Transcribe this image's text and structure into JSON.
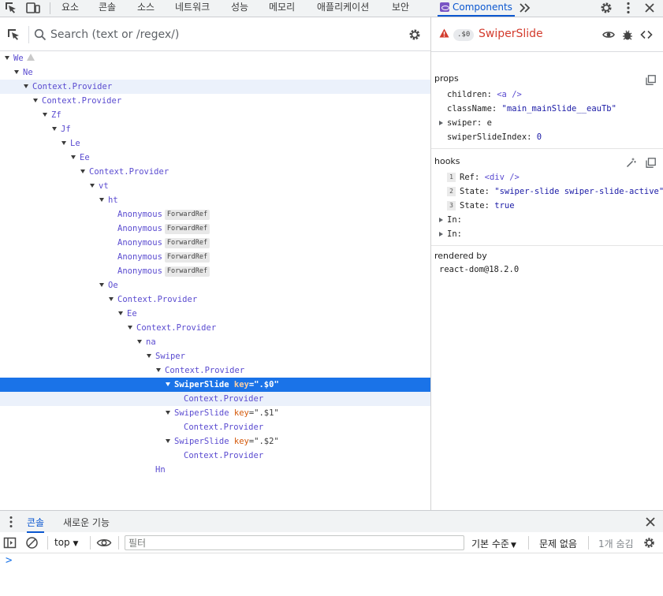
{
  "top_tabs": [
    "요소",
    "콘솔",
    "소스",
    "네트워크",
    "성능",
    "메모리",
    "애플리케이션",
    "보안"
  ],
  "active_tab": "Components",
  "more_tabs_icon": "chevron-double-right-icon",
  "search": {
    "placeholder": "Search (text or /regex/)"
  },
  "tree": [
    {
      "label": "We",
      "warning": true
    },
    {
      "label": "Ne"
    },
    {
      "label": "Context.Provider"
    },
    {
      "label": "Context.Provider"
    },
    {
      "label": "Zf"
    },
    {
      "label": "Jf"
    },
    {
      "label": "Le"
    },
    {
      "label": "Ee"
    },
    {
      "label": "Context.Provider"
    },
    {
      "label": "vt"
    },
    {
      "label": "ht"
    },
    {
      "label": "Anonymous",
      "badge": "ForwardRef"
    },
    {
      "label": "Anonymous",
      "badge": "ForwardRef"
    },
    {
      "label": "Anonymous",
      "badge": "ForwardRef"
    },
    {
      "label": "Anonymous",
      "badge": "ForwardRef"
    },
    {
      "label": "Anonymous",
      "badge": "ForwardRef"
    },
    {
      "label": "Oe"
    },
    {
      "label": "Context.Provider"
    },
    {
      "label": "Ee"
    },
    {
      "label": "Context.Provider"
    },
    {
      "label": "na"
    },
    {
      "label": "Swiper"
    },
    {
      "label": "Context.Provider"
    },
    {
      "label": "SwiperSlide",
      "key_name": "key",
      "key_value": "=\".$0\""
    },
    {
      "label": "Context.Provider"
    },
    {
      "label": "SwiperSlide",
      "key_name": "key",
      "key_value": "=\".$1\""
    },
    {
      "label": "Context.Provider"
    },
    {
      "label": "SwiperSlide",
      "key_name": "key",
      "key_value": "=\".$2\""
    },
    {
      "label": "Context.Provider"
    },
    {
      "label": "Hn"
    }
  ],
  "inspector": {
    "key_badge": ".$0",
    "title": "SwiperSlide",
    "props_title": "props",
    "props": [
      {
        "name": "children:",
        "value": "<a />",
        "kind": "tag"
      },
      {
        "name": "className:",
        "value": "\"main_mainSlide__eauTb\"",
        "kind": "str"
      },
      {
        "name": "swiper:",
        "value": "e",
        "kind": "plain",
        "expandable": true
      },
      {
        "name": "swiperSlideIndex:",
        "value": "0",
        "kind": "num"
      }
    ],
    "hooks_title": "hooks",
    "hooks": [
      {
        "index": "1",
        "name": "Ref:",
        "value": "<div />",
        "kind": "tag"
      },
      {
        "index": "2",
        "name": "State:",
        "value": "\"swiper-slide swiper-slide-active\"",
        "kind": "str"
      },
      {
        "index": "3",
        "name": "State:",
        "value": "true",
        "kind": "num"
      },
      {
        "name": "In:",
        "value": "",
        "expandable": true
      },
      {
        "name": "In:",
        "value": "",
        "expandable": true
      }
    ],
    "rendered_by_title": "rendered by",
    "rendered_by": "react-dom@18.2.0"
  },
  "drawer": {
    "tabs": [
      "콘솔",
      "새로운 기능"
    ],
    "context": "top",
    "filter_placeholder": "필터",
    "level": "기본 수준",
    "issues": "문제 없음",
    "hidden": "1개 숨김",
    "prompt": ">"
  },
  "colors": {
    "accent": "#0b57d0",
    "selected_row": "#1a73e8",
    "component_name": "#5a4bd0",
    "error_title": "#d33b2d",
    "key_name": "#d4590a"
  }
}
